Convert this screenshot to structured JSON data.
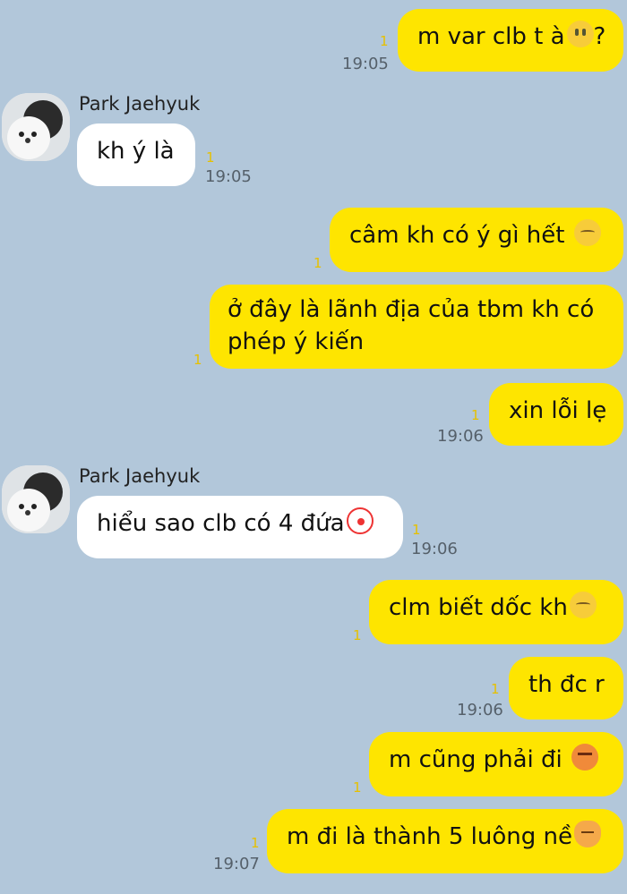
{
  "colors": {
    "background": "#b2c7da",
    "sent_bubble": "#fee500",
    "received_bubble": "#ffffff"
  },
  "contact": {
    "name": "Park Jaehyuk"
  },
  "messages": [
    {
      "side": "sent",
      "text": "m var clb t à",
      "emoji": "smile-emoji",
      "suffix": "?",
      "unread": "1",
      "time": "19:05"
    },
    {
      "side": "received",
      "sender": "Park Jaehyuk",
      "text": "kh ý là",
      "unread": "1",
      "time": "19:05"
    },
    {
      "side": "sent",
      "text": "câm kh có ý gì hết ",
      "emoji": "sad-emoji",
      "unread": "1"
    },
    {
      "side": "sent",
      "text_line1": "ở đây là lãnh địa của tbm kh có",
      "text_line2": "phép ý kiến",
      "unread": "1"
    },
    {
      "side": "sent",
      "text": "xin lỗi lẹ",
      "unread": "1",
      "time": "19:06"
    },
    {
      "side": "received",
      "sender": "Park Jaehyuk",
      "text": "hiểu sao clb có 4 đứa",
      "emoji": "clown-emoji",
      "unread": "1",
      "time": "19:06"
    },
    {
      "side": "sent",
      "text": "clm biết dốc kh",
      "emoji": "sad-emoji",
      "unread": "1"
    },
    {
      "side": "sent",
      "text": "th đc r",
      "unread": "1",
      "time": "19:06"
    },
    {
      "side": "sent",
      "text": "m cũng phải đi ",
      "emoji": "angry-emoji",
      "unread": "1"
    },
    {
      "side": "sent",
      "text": "m đi là thành 5 luông nề",
      "emoji": "cat-emoji",
      "unread": "1",
      "time": "19:07"
    }
  ]
}
